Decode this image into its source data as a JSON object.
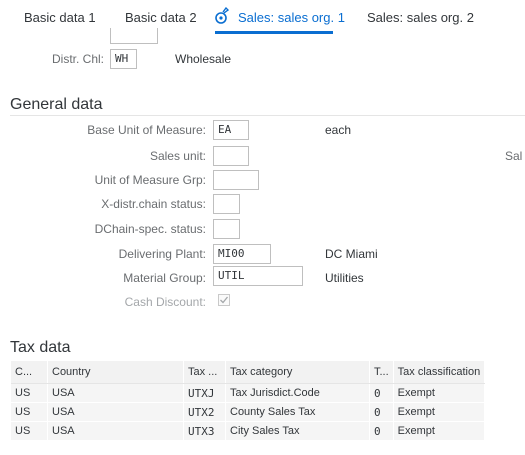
{
  "tabs": [
    {
      "label": "Basic data 1"
    },
    {
      "label": "Basic data 2"
    },
    {
      "label": "Sales: sales org. 1",
      "active": true
    },
    {
      "label": "Sales: sales org. 2"
    }
  ],
  "sales_org": {
    "distr_chl_label": "Distr. Chl:",
    "distr_chl_value": "WH",
    "distr_chl_desc": "Wholesale"
  },
  "general_data": {
    "title": "General data",
    "base_uom_label": "Base Unit of Measure:",
    "base_uom_value": "EA",
    "base_uom_desc": "each",
    "sales_unit_label": "Sales unit:",
    "sales_unit_value": "",
    "sales_unit_right_cut": "Sal",
    "uom_grp_label": "Unit of Measure Grp:",
    "uom_grp_value": "",
    "xdistr_label": "X-distr.chain status:",
    "xdistr_value": "",
    "dchain_label": "DChain-spec. status:",
    "dchain_value": "",
    "plant_label": "Delivering Plant:",
    "plant_value": "MI00",
    "plant_desc": "DC Miami",
    "matgrp_label": "Material Group:",
    "matgrp_value": "UTIL",
    "matgrp_desc": "Utilities",
    "cash_discount_label": "Cash Discount:",
    "cash_discount_checked": true
  },
  "tax_data": {
    "title": "Tax data",
    "columns": [
      "C...",
      "Country",
      "Tax ...",
      "Tax category",
      "T...",
      "Tax classification"
    ],
    "rows": [
      [
        "US",
        "USA",
        "UTXJ",
        "Tax Jurisdict.Code",
        "0",
        "Exempt"
      ],
      [
        "US",
        "USA",
        "UTX2",
        "County Sales Tax",
        "0",
        "Exempt"
      ],
      [
        "US",
        "USA",
        "UTX3",
        "City Sales Tax",
        "0",
        "Exempt"
      ]
    ]
  },
  "colors": {
    "accent": "#0a6ed1",
    "label": "#6a6d70",
    "text": "#32363a"
  }
}
